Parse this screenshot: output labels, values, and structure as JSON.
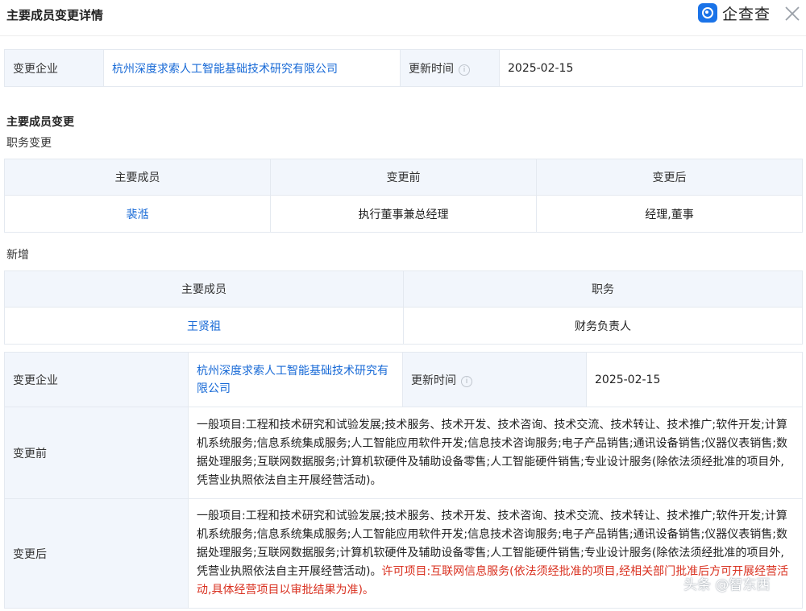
{
  "header": {
    "title": "主要成员变更详情",
    "logo_text": "企查查"
  },
  "summary": {
    "company_label": "变更企业",
    "company_name": "杭州深度求索人工智能基础技术研究有限公司",
    "update_label": "更新时间",
    "update_date": "2025-02-15"
  },
  "members_section": {
    "title": "主要成员变更",
    "duty_change": {
      "label": "职务变更",
      "headers": [
        "主要成员",
        "变更前",
        "变更后"
      ],
      "rows": [
        {
          "member": "裴湉",
          "before": "执行董事兼总经理",
          "after": "经理,董事"
        }
      ]
    },
    "added": {
      "label": "新增",
      "headers": [
        "主要成员",
        "职务"
      ],
      "rows": [
        {
          "member": "王贤祖",
          "position": "财务负责人"
        }
      ]
    }
  },
  "scope_change": {
    "company_label": "变更企业",
    "company_name": "杭州深度求索人工智能基础技术研究有限公司",
    "update_label": "更新时间",
    "update_date": "2025-02-15",
    "before_label": "变更前",
    "before_text": "一般项目:工程和技术研究和试验发展;技术服务、技术开发、技术咨询、技术交流、技术转让、技术推广;软件开发;计算机系统服务;信息系统集成服务;人工智能应用软件开发;信息技术咨询服务;电子产品销售;通讯设备销售;仪器仪表销售;数据处理服务;互联网数据服务;计算机软硬件及辅助设备零售;人工智能硬件销售;专业设计服务(除依法须经批准的项目外,凭营业执照依法自主开展经营活动)。",
    "after_label": "变更后",
    "after_text": "一般项目:工程和技术研究和试验发展;技术服务、技术开发、技术咨询、技术交流、技术转让、技术推广;软件开发;计算机系统服务;信息系统集成服务;人工智能应用软件开发;信息技术咨询服务;电子产品销售;通讯设备销售;仪器仪表销售;数据处理服务;互联网数据服务;计算机软硬件及辅助设备零售;人工智能硬件销售;专业设计服务(除依法须经批准的项目外,凭营业执照依法自主开展经营活动)。",
    "after_text_added": "许可项目:互联网信息服务(依法须经批准的项目,经相关部门批准后方可开展经营活动,具体经营项目以审批结果为准)。"
  },
  "watermark": "头条 @智东西",
  "colors": {
    "link": "#1769d6",
    "label_bg": "#f2f6fc",
    "added_text": "#d9301f",
    "border": "#e4e9f0"
  },
  "icons": [
    "qichacha-logo-icon",
    "close-icon",
    "info-icon"
  ]
}
